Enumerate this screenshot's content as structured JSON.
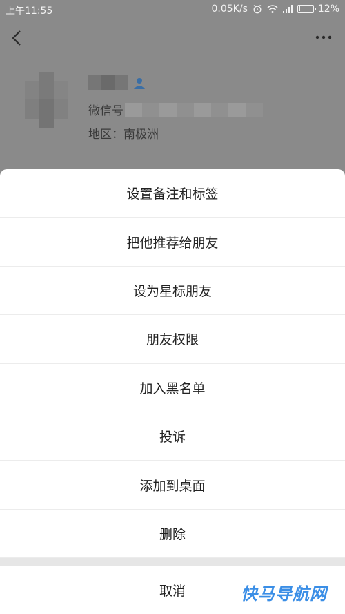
{
  "status_bar": {
    "time": "上午11:55",
    "network_speed": "0.05K/s",
    "battery": "12%",
    "battery_level": 0.12
  },
  "nav": {
    "back_icon": "chevron-left-icon",
    "more_icon": "more-dots-icon"
  },
  "profile": {
    "wechat_id_label": "微信号",
    "region": "地区：南极洲"
  },
  "menu": {
    "items": [
      "设置备注和标签",
      "把他推荐给朋友",
      "设为星标朋友",
      "朋友权限",
      "加入黑名单",
      "投诉",
      "添加到桌面",
      "删除"
    ],
    "cancel": "取消"
  },
  "watermark": "快马导航网",
  "colors": {
    "overlay_background": "#8a8a8a",
    "sheet_background": "#ffffff",
    "separator": "#e6e6e6",
    "watermark": "#3a8ee6"
  }
}
